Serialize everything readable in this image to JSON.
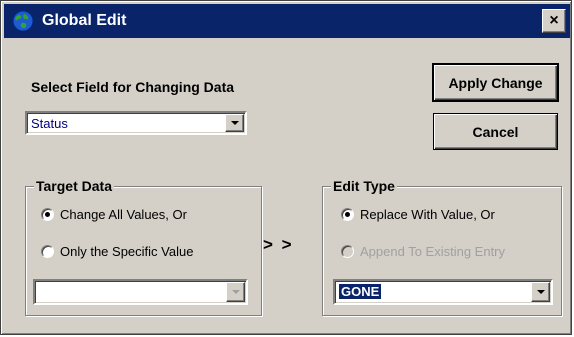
{
  "window": {
    "title": "Global Edit",
    "icon": "globe-icon",
    "close_label": "×"
  },
  "select_field": {
    "label": "Select Field for Changing Data",
    "value": "Status"
  },
  "buttons": {
    "apply_label": "Apply Change",
    "cancel_label": "Cancel"
  },
  "target_data": {
    "title": "Target Data",
    "option_all": "Change All Values, Or",
    "option_specific": "Only the Specific Value",
    "value": ""
  },
  "separator": "> >",
  "edit_type": {
    "title": "Edit Type",
    "option_replace": "Replace With Value, Or",
    "option_append": "Append To Existing Entry",
    "value": "GONE"
  },
  "colors": {
    "titlebar": "#0a246a",
    "face": "#d4d0c8",
    "select_text": "#000080"
  }
}
